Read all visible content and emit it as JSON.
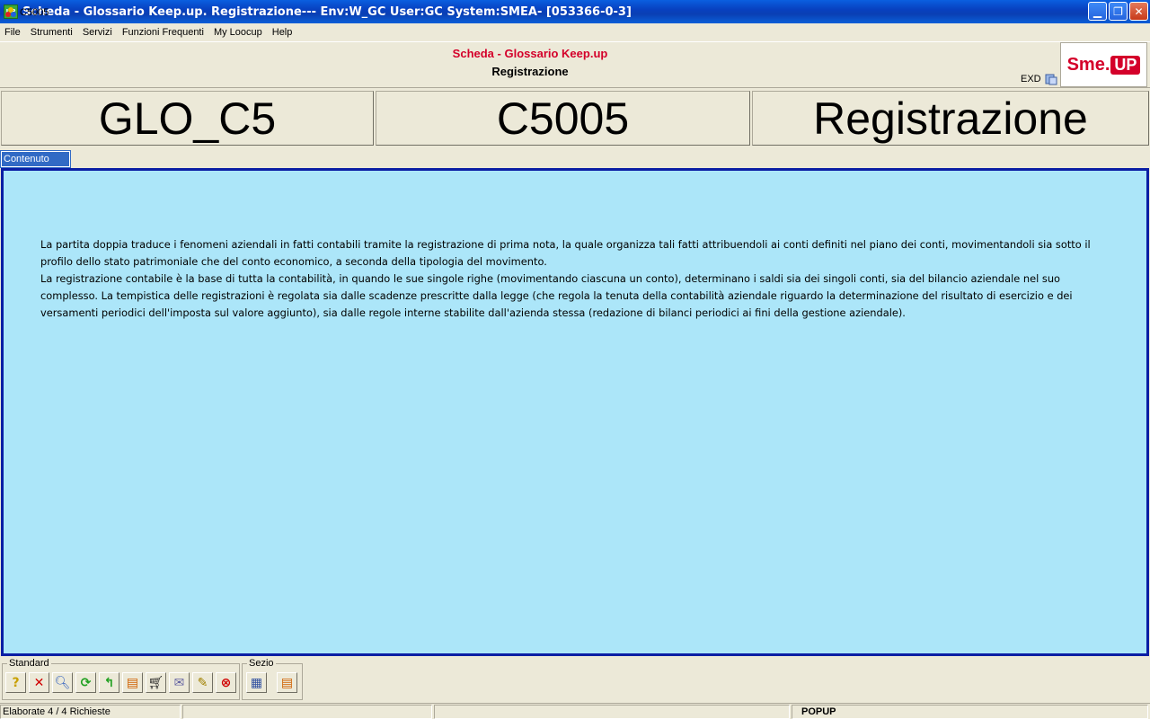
{
  "window": {
    "title": "Scheda - Glossario Keep.up. Registrazione--- Env:W_GC User:GC System:SMEA- [053366-0-3]",
    "app_icon_text": "UP"
  },
  "menu": [
    "File",
    "Strumenti",
    "Servizi",
    "Funzioni Frequenti",
    "My Loocup",
    "Help"
  ],
  "header": {
    "code": "C5005",
    "title": "Scheda - Glossario Keep.up",
    "subtitle": "Registrazione",
    "exd": "EXD",
    "logo_left": "Sme.",
    "logo_right": "UP"
  },
  "fields": [
    "GLO_C5",
    "C5005",
    "Registrazione"
  ],
  "tab": "Contenuto",
  "content": {
    "p1": "La partita doppia traduce i fenomeni aziendali in fatti contabili tramite la registrazione di prima nota, la quale organizza tali fatti attribuendoli ai conti definiti nel piano dei conti, movimentandoli sia sotto il profilo dello stato patrimoniale che del conto economico, a seconda della tipologia del movimento.",
    "p2": "La registrazione contabile è la base di tutta la contabilità, in quando le sue singole righe (movimentando ciascuna un conto), determinano i saldi sia dei singoli conti, sia del bilancio aziendale nel suo complesso. La tempistica delle registrazioni è regolata sia dalle scadenze prescritte dalla legge (che regola la tenuta della contabilità aziendale riguardo la determinazione del risultato di esercizio e dei versamenti periodici dell'imposta sul valore aggiunto), sia dalle regole interne stabilite dall'azienda stessa (redazione di bilanci periodici ai fini della gestione aziendale)."
  },
  "toolbar": {
    "group1_label": "Standard",
    "group2_label": "Sezio",
    "buttons": [
      "help-icon",
      "close-icon",
      "search-icon",
      "refresh-icon",
      "back-icon",
      "export-icon",
      "cart-icon",
      "mail-icon",
      "magic-icon",
      "stop-icon"
    ],
    "group2_buttons": [
      "list-icon",
      "export-icon"
    ]
  },
  "statusbar": {
    "left": "Elaborate 4 / 4 Richieste",
    "right": "POPUP"
  }
}
